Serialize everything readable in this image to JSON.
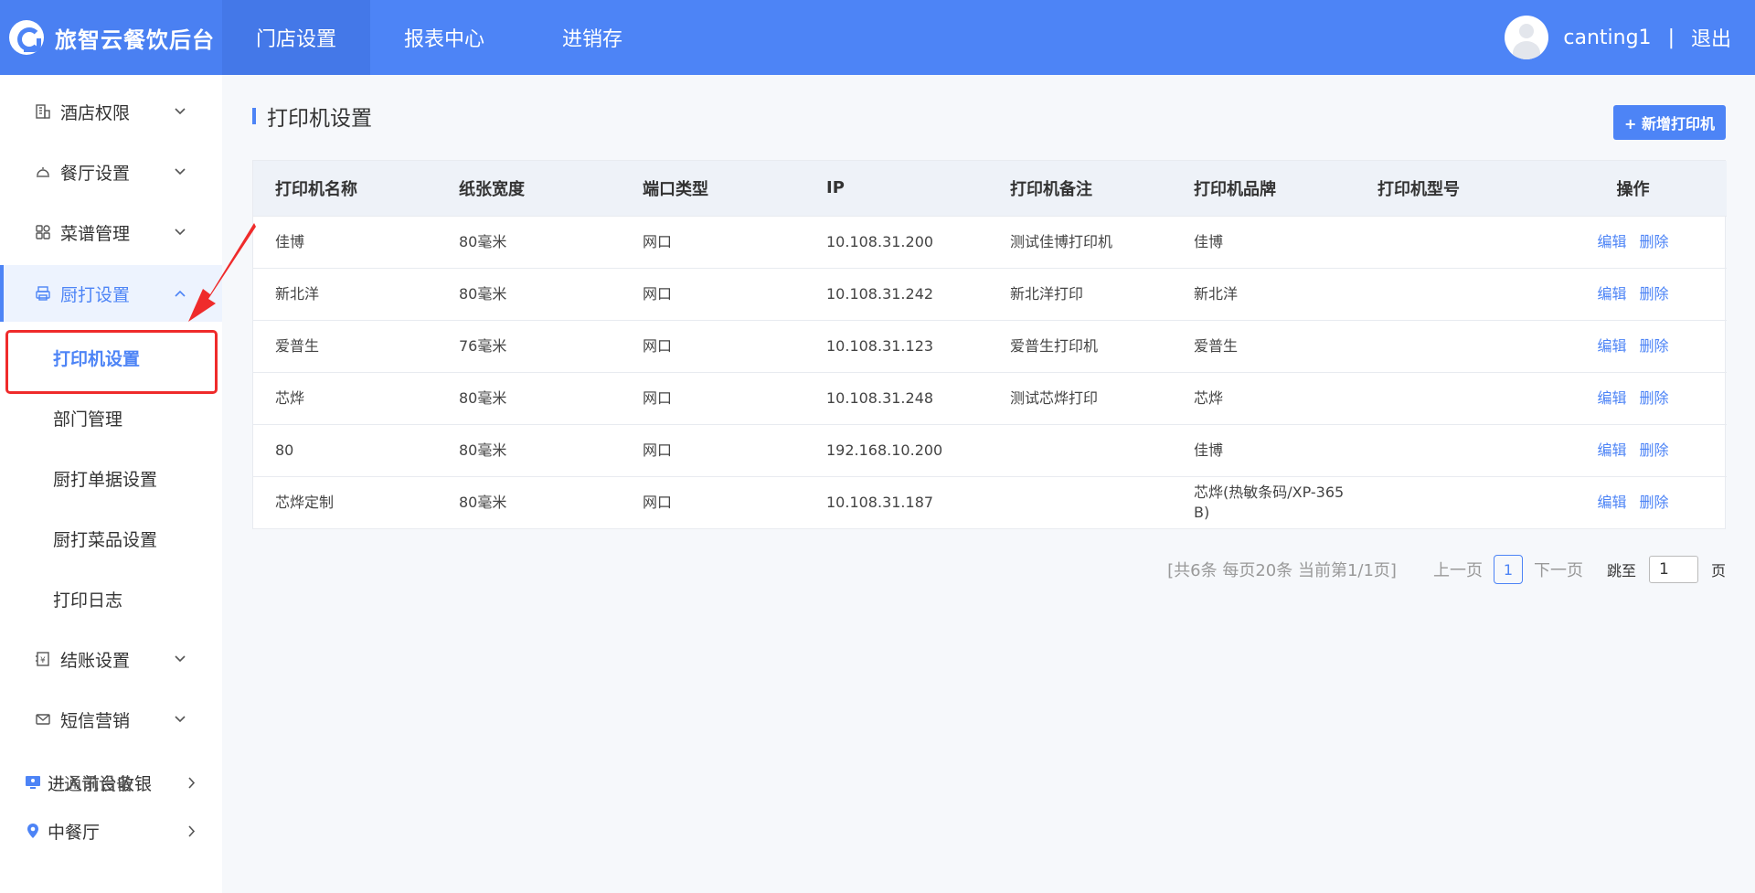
{
  "header": {
    "app_title": "旅智云餐饮后台",
    "nav": [
      {
        "label": "门店设置",
        "active": true
      },
      {
        "label": "报表中心",
        "active": false
      },
      {
        "label": "进销存",
        "active": false
      }
    ],
    "username": "canting1",
    "separator": "|",
    "logout_label": "退出"
  },
  "sidebar": {
    "items": [
      {
        "label": "酒店权限",
        "icon": "building-icon"
      },
      {
        "label": "餐厅设置",
        "icon": "cloche-icon"
      },
      {
        "label": "菜谱管理",
        "icon": "grid-icon"
      },
      {
        "label": "厨打设置",
        "icon": "printer-icon"
      }
    ],
    "sub_items": [
      {
        "label": "打印机设置",
        "active": true
      },
      {
        "label": "部门管理"
      },
      {
        "label": "厨打单据设置"
      },
      {
        "label": "厨打菜品设置"
      },
      {
        "label": "打印日志"
      }
    ],
    "items_after": [
      {
        "label": "结账设置",
        "icon": "receipt-icon"
      },
      {
        "label": "短信营销",
        "icon": "mail-icon"
      }
    ],
    "bottom": {
      "enter_label": "进入前台收银",
      "overlap_label": "通讯设备",
      "location_label": "中餐厅"
    }
  },
  "main": {
    "page_title": "打印机设置",
    "add_button": "+ 新增打印机",
    "table": {
      "columns": [
        "打印机名称",
        "纸张宽度",
        "端口类型",
        "IP",
        "打印机备注",
        "打印机品牌",
        "打印机型号",
        "操作"
      ],
      "rows": [
        {
          "name": "佳博",
          "width": "80毫米",
          "port": "网口",
          "ip": "10.108.31.200",
          "note": "测试佳博打印机",
          "brand": "佳博",
          "model": ""
        },
        {
          "name": "新北洋",
          "width": "80毫米",
          "port": "网口",
          "ip": "10.108.31.242",
          "note": "新北洋打印",
          "brand": "新北洋",
          "model": ""
        },
        {
          "name": "爱普生",
          "width": "76毫米",
          "port": "网口",
          "ip": "10.108.31.123",
          "note": "爱普生打印机",
          "brand": "爱普生",
          "model": ""
        },
        {
          "name": "芯烨",
          "width": "80毫米",
          "port": "网口",
          "ip": "10.108.31.248",
          "note": "测试芯烨打印",
          "brand": "芯烨",
          "model": ""
        },
        {
          "name": "80",
          "width": "80毫米",
          "port": "网口",
          "ip": "192.168.10.200",
          "note": "",
          "brand": "佳博",
          "model": ""
        },
        {
          "name": "芯烨定制",
          "width": "80毫米",
          "port": "网口",
          "ip": "10.108.31.187",
          "note": "",
          "brand": "芯烨(热敏条码/XP-365B)",
          "model": ""
        }
      ],
      "edit_label": "编辑",
      "delete_label": "删除"
    },
    "pager": {
      "info": "[共6条 每页20条 当前第1/1页]",
      "prev": "上一页",
      "current": "1",
      "next": "下一页",
      "jump_label": "跳至",
      "jump_value": "1",
      "page_unit": "页"
    }
  },
  "colors": {
    "primary": "#4d84f6",
    "highlight": "#ef2b2b"
  }
}
